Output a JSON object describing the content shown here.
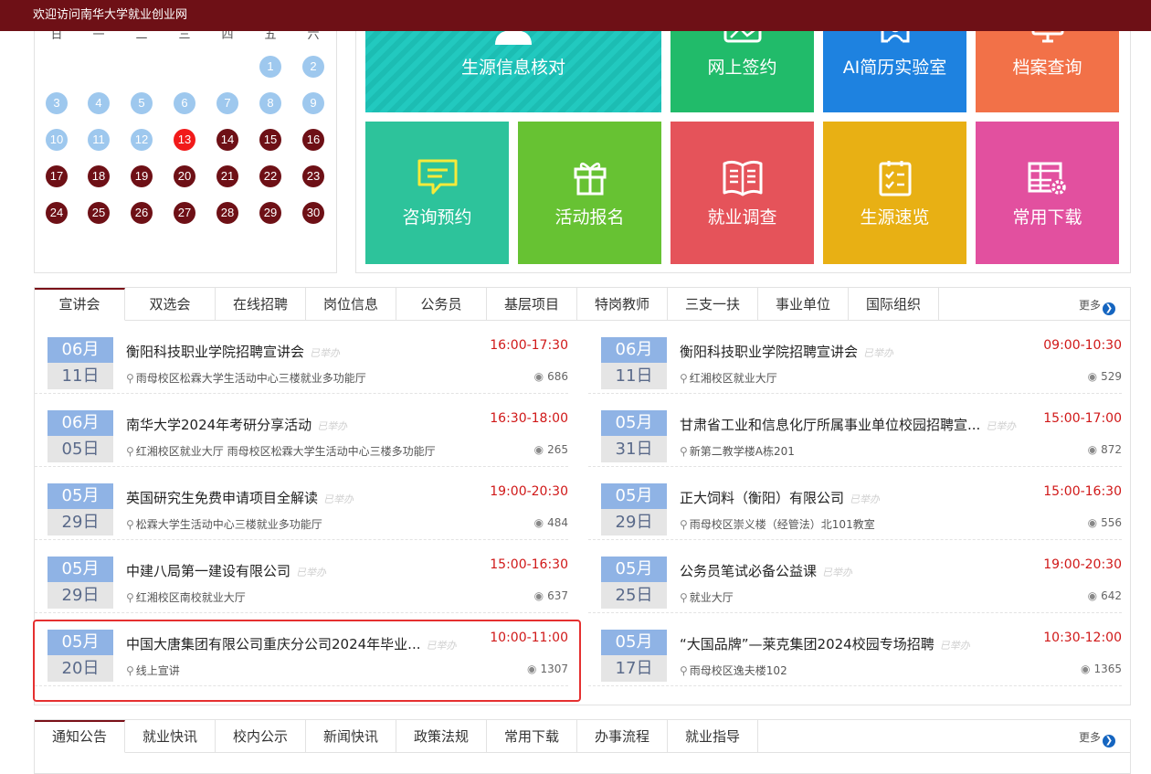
{
  "site": {
    "welcome": "欢迎访问南华大学就业创业网"
  },
  "calendar": {
    "weekdays": [
      "一",
      "二",
      "三",
      "四",
      "五",
      "六",
      "日"
    ],
    "days": [
      {
        "n": "1",
        "state": "past"
      },
      {
        "n": "2",
        "state": "past"
      },
      {
        "n": "3",
        "state": "past"
      },
      {
        "n": "4",
        "state": "past"
      },
      {
        "n": "5",
        "state": "past"
      },
      {
        "n": "6",
        "state": "past"
      },
      {
        "n": "7",
        "state": "past"
      },
      {
        "n": "8",
        "state": "past"
      },
      {
        "n": "9",
        "state": "past"
      },
      {
        "n": "10",
        "state": "past"
      },
      {
        "n": "11",
        "state": "past"
      },
      {
        "n": "12",
        "state": "past"
      },
      {
        "n": "13",
        "state": "today"
      },
      {
        "n": "14",
        "state": "future"
      },
      {
        "n": "15",
        "state": "future"
      },
      {
        "n": "16",
        "state": "future"
      },
      {
        "n": "17",
        "state": "future"
      },
      {
        "n": "18",
        "state": "future"
      },
      {
        "n": "19",
        "state": "future"
      },
      {
        "n": "20",
        "state": "future"
      },
      {
        "n": "21",
        "state": "future"
      },
      {
        "n": "22",
        "state": "future"
      },
      {
        "n": "23",
        "state": "future"
      },
      {
        "n": "24",
        "state": "future"
      },
      {
        "n": "25",
        "state": "future"
      },
      {
        "n": "26",
        "state": "future"
      },
      {
        "n": "27",
        "state": "future"
      },
      {
        "n": "28",
        "state": "future"
      },
      {
        "n": "29",
        "state": "future"
      },
      {
        "n": "30",
        "state": "future"
      }
    ],
    "colors": {
      "past": "#9ec8ee",
      "today": "#f11a1a",
      "future": "#6e1016"
    }
  },
  "tiles": [
    {
      "label": "生源信息核对",
      "icon": "person-icon",
      "color": "#22c9bf"
    },
    {
      "label": "网上签约",
      "icon": "contract-icon",
      "color": "#21bb6a"
    },
    {
      "label": "AI简历实验室",
      "icon": "ai-resume-icon",
      "color": "#1e82e0"
    },
    {
      "label": "档案查询",
      "icon": "monitor-icon",
      "color": "#f27148"
    },
    {
      "label": "咨询预约",
      "icon": "chat-icon",
      "color": "#2dc39b"
    },
    {
      "label": "活动报名",
      "icon": "gift-icon",
      "color": "#67c233"
    },
    {
      "label": "就业调查",
      "icon": "book-icon",
      "color": "#e5535a"
    },
    {
      "label": "生源速览",
      "icon": "clipboard-icon",
      "color": "#e8b014"
    },
    {
      "label": "常用下载",
      "icon": "table-gear-icon",
      "color": "#e2509f"
    }
  ],
  "talks": {
    "tabs": [
      "宣讲会",
      "双选会",
      "在线招聘",
      "岗位信息",
      "公务员",
      "基层项目",
      "特岗教师",
      "三支一扶",
      "事业单位",
      "国际组织"
    ],
    "more": "更多",
    "status_label": "已举办",
    "events": [
      {
        "month": "06月",
        "day": "11日",
        "title": "衡阳科技职业学院招聘宣讲会",
        "time": "16:00-17:30",
        "location": "雨母校区松霖大学生活动中心三楼就业多功能厅",
        "views": "686"
      },
      {
        "month": "06月",
        "day": "11日",
        "title": "衡阳科技职业学院招聘宣讲会",
        "time": "09:00-10:30",
        "location": "红湘校区就业大厅",
        "views": "529"
      },
      {
        "month": "06月",
        "day": "05日",
        "title": "南华大学2024年考研分享活动",
        "time": "16:30-18:00",
        "location": "红湘校区就业大厅 雨母校区松霖大学生活动中心三楼多功能厅",
        "views": "265"
      },
      {
        "month": "05月",
        "day": "31日",
        "title": "甘肃省工业和信息化厅所属事业单位校园招聘宣...",
        "time": "15:00-17:00",
        "location": "新第二教学楼A栋201",
        "views": "872"
      },
      {
        "month": "05月",
        "day": "29日",
        "title": "英国研究生免费申请项目全解读",
        "time": "19:00-20:30",
        "location": "松霖大学生活动中心三楼就业多功能厅",
        "views": "484"
      },
      {
        "month": "05月",
        "day": "29日",
        "title": "正大饲料（衡阳）有限公司",
        "time": "15:00-16:30",
        "location": "雨母校区崇义楼（经管法）北101教室",
        "views": "556"
      },
      {
        "month": "05月",
        "day": "29日",
        "title": "中建八局第一建设有限公司",
        "time": "15:00-16:30",
        "location": "红湘校区南校就业大厅",
        "views": "637"
      },
      {
        "month": "05月",
        "day": "25日",
        "title": "公务员笔试必备公益课",
        "time": "19:00-20:30",
        "location": "就业大厅",
        "views": "642"
      },
      {
        "month": "05月",
        "day": "20日",
        "title": "中国大唐集团有限公司重庆分公司2024年毕业...",
        "time": "10:00-11:00",
        "location": "线上宣讲",
        "views": "1307"
      },
      {
        "month": "05月",
        "day": "17日",
        "title": "“大国品牌”—莱克集团2024校园专场招聘",
        "time": "10:30-12:00",
        "location": "雨母校区逸夫楼102",
        "views": "1365"
      }
    ]
  },
  "news": {
    "tabs": [
      "通知公告",
      "就业快讯",
      "校内公示",
      "新闻快讯",
      "政策法规",
      "常用下载",
      "办事流程",
      "就业指导"
    ],
    "more": "更多"
  }
}
